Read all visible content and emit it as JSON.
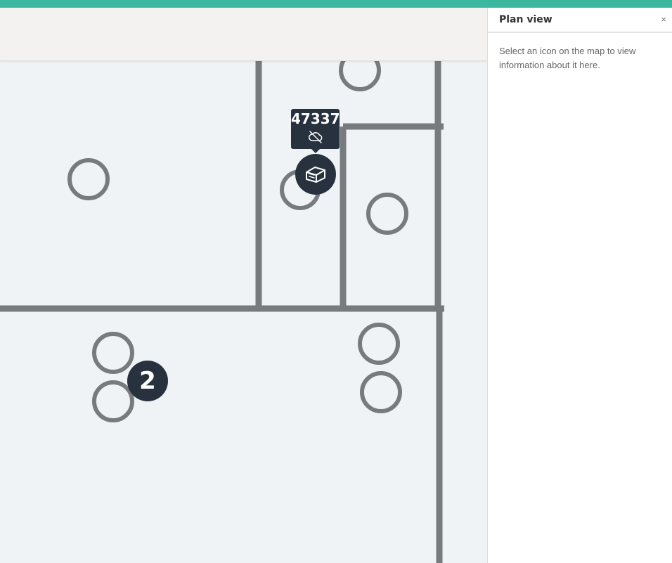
{
  "map": {
    "tooltip": {
      "device_id": "47337",
      "status_icon": "cloud-off-icon"
    },
    "device_marker_icon": "device-icon",
    "cluster_count": "2"
  },
  "side_panel": {
    "title": "Plan view",
    "close_label": "×",
    "body_text": "Select an icon on the map to view information about it here."
  },
  "colors": {
    "accent_bar": "#3db8a0",
    "marker_fill": "#27323e",
    "wall": "#777b7e",
    "map_background": "#f0f3f6"
  }
}
